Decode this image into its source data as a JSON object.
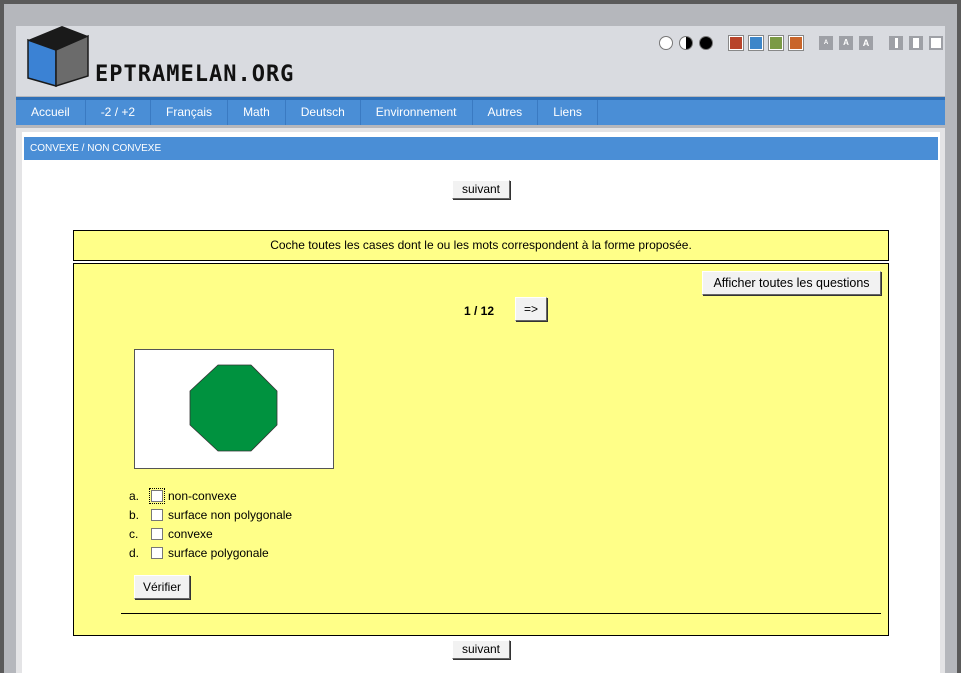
{
  "header": {
    "site_name": "EPTRAMELAN.ORG",
    "toolbar": {
      "contrast_icons": [
        "contrast-white-icon",
        "contrast-half-icon",
        "contrast-black-icon"
      ],
      "color_icons": [
        {
          "name": "color-red-icon",
          "color": "#b8442a"
        },
        {
          "name": "color-blue-icon",
          "color": "#3d86c9"
        },
        {
          "name": "color-green-icon",
          "color": "#7b9a45"
        },
        {
          "name": "color-orange-icon",
          "color": "#c9652a"
        }
      ],
      "font_size_icons": [
        "font-small-icon",
        "font-medium-icon",
        "font-large-icon"
      ],
      "width_icons": [
        "width-narrow-icon",
        "width-medium-icon",
        "width-wide-icon"
      ]
    }
  },
  "nav": {
    "items": [
      "Accueil",
      "-2 / +2",
      "Français",
      "Math",
      "Deutsch",
      "Environnement",
      "Autres",
      "Liens"
    ]
  },
  "breadcrumb": "CONVEXE / NON CONVEXE",
  "buttons": {
    "next_top": "suivant",
    "next_bottom": "suivant",
    "show_all": "Afficher toutes les questions",
    "arrow": "=>",
    "verify": "Vérifier"
  },
  "instruction": "Coche toutes les cases dont le ou les mots correspondent à la forme proposée.",
  "quiz": {
    "counter": "1 / 12",
    "shape_color": "#00923f",
    "answers": [
      {
        "letter": "a.",
        "label": "non-convexe"
      },
      {
        "letter": "b.",
        "label": "surface non polygonale"
      },
      {
        "letter": "c.",
        "label": "convexe"
      },
      {
        "letter": "d.",
        "label": "surface polygonale"
      }
    ]
  }
}
